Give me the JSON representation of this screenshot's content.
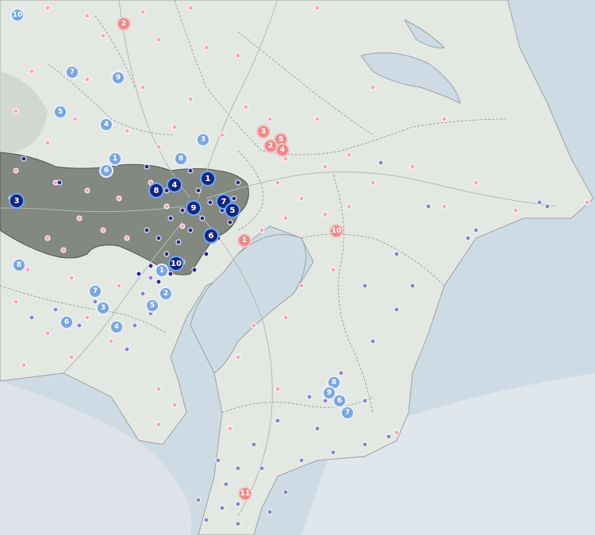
{
  "colors": {
    "sea": "#c9d8e4",
    "land": "#e3e7e2",
    "tokyo_fill": "#6f736f",
    "pink_dot": "#f3a7c6",
    "purple_dot": "#8d86c8",
    "navy_dot": "#2c2b8f",
    "light_marker": "#7aa6dc",
    "dark_marker": "#16277a",
    "red_marker": "#eb8a8a"
  },
  "markers": {
    "light_blue": [
      {
        "label": "10"
      },
      {
        "label": "7"
      },
      {
        "label": "9"
      },
      {
        "label": "5"
      },
      {
        "label": "4"
      },
      {
        "label": "3"
      },
      {
        "label": "1"
      },
      {
        "label": "6"
      },
      {
        "label": "8"
      },
      {
        "label": "8"
      },
      {
        "label": "1"
      },
      {
        "label": "2"
      },
      {
        "label": "7"
      },
      {
        "label": "3"
      },
      {
        "label": "5"
      },
      {
        "label": "6"
      },
      {
        "label": "4"
      },
      {
        "label": "8"
      },
      {
        "label": "9"
      },
      {
        "label": "6"
      },
      {
        "label": "7"
      }
    ],
    "dark_blue": [
      {
        "label": "1"
      },
      {
        "label": "4"
      },
      {
        "label": "8"
      },
      {
        "label": "3"
      },
      {
        "label": "9"
      },
      {
        "label": "7"
      },
      {
        "label": "5"
      },
      {
        "label": "6"
      },
      {
        "label": "10"
      }
    ],
    "red": [
      {
        "label": "2"
      },
      {
        "label": "3"
      },
      {
        "label": "5"
      },
      {
        "label": "2"
      },
      {
        "label": "4"
      },
      {
        "label": "1"
      },
      {
        "label": "10"
      },
      {
        "label": "11"
      }
    ]
  }
}
